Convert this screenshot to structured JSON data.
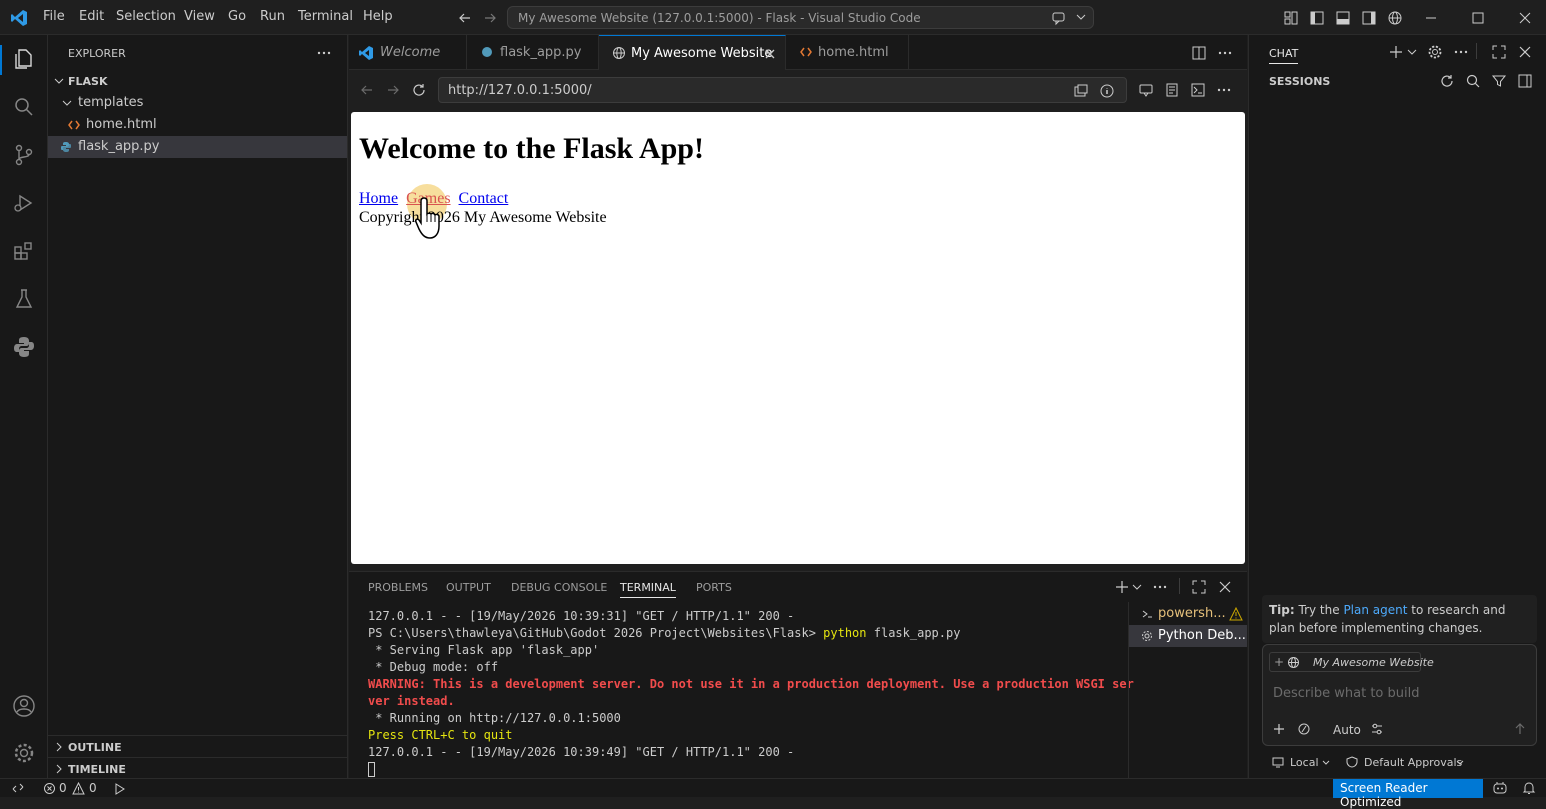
{
  "window": {
    "title": "My Awesome Website (127.0.0.1:5000) - Flask - Visual Studio Code",
    "menu": [
      "File",
      "Edit",
      "Selection",
      "View",
      "Go",
      "Run",
      "Terminal",
      "Help"
    ]
  },
  "sidebar": {
    "title": "EXPLORER",
    "folder": "FLASK",
    "tree": [
      {
        "label": "templates",
        "type": "folder"
      },
      {
        "label": "home.html",
        "type": "html"
      },
      {
        "label": "flask_app.py",
        "type": "python"
      }
    ],
    "outline": "OUTLINE",
    "timeline": "TIMELINE"
  },
  "tabs": [
    {
      "label": "Welcome",
      "italic": true
    },
    {
      "label": "flask_app.py"
    },
    {
      "label": "My Awesome Website",
      "active": true
    },
    {
      "label": "home.html"
    }
  ],
  "browser": {
    "url": "http://127.0.0.1:5000/"
  },
  "webpage": {
    "heading": "Welcome to the Flask App!",
    "links": [
      "Home",
      "Games",
      "Contact"
    ],
    "footer": "Copyright 2026 My Awesome Website"
  },
  "panel": {
    "tabs": [
      "PROBLEMS",
      "OUTPUT",
      "DEBUG CONSOLE",
      "TERMINAL",
      "PORTS"
    ],
    "active_tab": "TERMINAL",
    "terminal_lines": {
      "l1": "127.0.0.1 - - [19/May/2026 10:39:31] \"GET / HTTP/1.1\" 200 -",
      "l2_prompt": "PS C:\\Users\\thawleya\\GitHub\\Godot 2026 Project\\Websites\\Flask> ",
      "l2_cmd": "python",
      "l2_arg": " flask_app.py",
      "l3": " * Serving Flask app 'flask_app'",
      "l4": " * Debug mode: off",
      "l5": "WARNING: This is a development server. Do not use it in a production deployment. Use a production WSGI ser",
      "l6": "ver instead.",
      "l7": " * Running on http://127.0.0.1:5000",
      "l8": "Press CTRL+C to quit",
      "l9": "127.0.0.1 - - [19/May/2026 10:39:49] \"GET / HTTP/1.1\" 200 -"
    },
    "terminals": [
      "powersh...",
      "Python Deb..."
    ]
  },
  "chat": {
    "title": "CHAT",
    "sessions": "SESSIONS",
    "tip_label": "Tip:",
    "tip_pre": " Try the ",
    "tip_link": "Plan agent",
    "tip_post": " to research and plan before implementing changes.",
    "context_chip": "My Awesome Website",
    "input_placeholder": "Describe what to build",
    "mode": "Auto",
    "location": "Local",
    "approvals": "Default Approvals"
  },
  "status": {
    "errors": "0",
    "warnings": "0",
    "screen_reader": "Screen Reader Optimized"
  },
  "colors": {
    "accent": "#0078d4",
    "warning_red": "#f14c4c",
    "terminal_yellow": "#e5e510"
  }
}
